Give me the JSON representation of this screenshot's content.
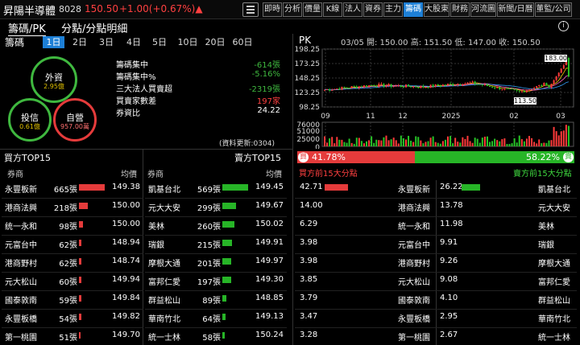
{
  "header": {
    "stock_name": "昇陽半導體",
    "stock_code": "8028",
    "price": "150.50",
    "change": "+1.00(+0.67%)▲",
    "tabs": [
      "即時",
      "分析",
      "價量",
      "K線",
      "法人",
      "資券",
      "主力",
      "籌碼",
      "大股東",
      "財務",
      "河流圖",
      "新聞/日曆",
      "董監/公司"
    ],
    "active_tab": "籌碼"
  },
  "subnav": {
    "tab1": "籌碼/PK",
    "tab2": "分點/分點明細",
    "info": "i"
  },
  "left": {
    "title": "籌碼",
    "periods": [
      "1日",
      "2日",
      "3日",
      "4日",
      "5日",
      "10日",
      "20日",
      "60日"
    ],
    "active_period": "1日",
    "rings": [
      {
        "label": "外資",
        "value": "2.95億",
        "color": "#3fb83f"
      },
      {
        "label": "投信",
        "value": "0.61億",
        "color": "#3fb83f"
      },
      {
        "label": "自營",
        "value": "957.00萬",
        "color": "#e53b3b"
      }
    ],
    "stats": [
      {
        "label": "籌碼集中",
        "value": "-614張",
        "color": "#3fb83f"
      },
      {
        "label": "籌碼集中%",
        "value": "-5.16%",
        "color": "#3fb83f"
      },
      {
        "label": "三大法人買賣超",
        "value": "-2319張",
        "color": "#3fb83f"
      },
      {
        "label": "買賣家數差",
        "value": "197家",
        "color": "#ff4040"
      },
      {
        "label": "券資比",
        "value": "24.22",
        "color": "#ffffff"
      }
    ],
    "update_note": "(資料更新:0304)"
  },
  "chart": {
    "pk_label": "PK",
    "ohlc_text": "03/05 開: 150.00  高: 151.50  低: 147.00  收: 150.50",
    "y_ticks": [
      "198.25",
      "173.25",
      "148.25",
      "123.25",
      "98.25"
    ],
    "vol_ticks": [
      "76000",
      "51000",
      "25000",
      "0"
    ],
    "x_ticks": [
      "09",
      "11",
      "12",
      "2025",
      "02",
      "03"
    ],
    "max_label": "183.00",
    "min_label": "113.50",
    "colors": {
      "up": "#ff3a3a",
      "down": "#27c427",
      "ma1": "#f0c800",
      "ma2": "#ff66cc",
      "ma3": "#33a0ff"
    }
  },
  "chart_data": {
    "type": "line",
    "title": "PK",
    "x": [
      "09",
      "11",
      "12",
      "2025",
      "02",
      "03"
    ],
    "series": [
      {
        "name": "收",
        "values": [
          128,
          136,
          133,
          140,
          124,
          150.5
        ]
      }
    ],
    "ylim": [
      98.25,
      198.25
    ]
  },
  "ratio": {
    "left": "41.78%",
    "right": "58.22%",
    "left_badge": "買",
    "right_badge": "賣"
  },
  "buy_table": {
    "title": "買方TOP15",
    "col_broker": "券商",
    "col_avg": "均價",
    "rows": [
      {
        "broker": "永豐板新",
        "qty": "665張",
        "avg": "149.38",
        "bar": 0.95
      },
      {
        "broker": "港商法興",
        "qty": "218張",
        "avg": "150.00",
        "bar": 0.31
      },
      {
        "broker": "统一永和",
        "qty": "98張",
        "avg": "150.00",
        "bar": 0.14
      },
      {
        "broker": "元富台中",
        "qty": "62張",
        "avg": "148.94",
        "bar": 0.09
      },
      {
        "broker": "港商野村",
        "qty": "62張",
        "avg": "148.74",
        "bar": 0.09
      },
      {
        "broker": "元大松山",
        "qty": "60張",
        "avg": "149.94",
        "bar": 0.09
      },
      {
        "broker": "國泰敦南",
        "qty": "59張",
        "avg": "149.84",
        "bar": 0.08
      },
      {
        "broker": "永豐板橋",
        "qty": "54張",
        "avg": "149.82",
        "bar": 0.08
      },
      {
        "broker": "第一桃園",
        "qty": "51張",
        "avg": "149.70",
        "bar": 0.07
      }
    ]
  },
  "sell_table": {
    "title": "賣方TOP15",
    "col_broker": "券商",
    "col_avg": "均價",
    "rows": [
      {
        "broker": "凱基台北",
        "qty": "569張",
        "avg": "149.45",
        "bar": 0.95
      },
      {
        "broker": "元大大安",
        "qty": "299張",
        "avg": "149.67",
        "bar": 0.5
      },
      {
        "broker": "美林",
        "qty": "260張",
        "avg": "150.02",
        "bar": 0.43
      },
      {
        "broker": "瑞銀",
        "qty": "215張",
        "avg": "149.91",
        "bar": 0.36
      },
      {
        "broker": "摩根大通",
        "qty": "201張",
        "avg": "149.97",
        "bar": 0.33
      },
      {
        "broker": "富邦仁愛",
        "qty": "197張",
        "avg": "149.30",
        "bar": 0.33
      },
      {
        "broker": "群益松山",
        "qty": "89張",
        "avg": "148.85",
        "bar": 0.15
      },
      {
        "broker": "華南竹北",
        "qty": "64張",
        "avg": "149.13",
        "bar": 0.11
      },
      {
        "broker": "統一士林",
        "qty": "58張",
        "avg": "150.24",
        "bar": 0.1
      }
    ]
  },
  "pk_table": {
    "buy_title": "買方前15大分點",
    "sell_title": "賣方前15大分點",
    "rows": [
      {
        "bval": "42.71",
        "bname": "永豐板新",
        "sval": "26.22",
        "sname": "凱基台北",
        "bbar": 0.95,
        "sbar": 0.6
      },
      {
        "bval": "14.00",
        "bname": "港商法興",
        "sval": "13.78",
        "sname": "元大大安",
        "bbar": 0.0,
        "sbar": 0.0
      },
      {
        "bval": "6.29",
        "bname": "統一永和",
        "sval": "11.98",
        "sname": "美林",
        "bbar": 0.0,
        "sbar": 0.0
      },
      {
        "bval": "3.98",
        "bname": "元富台中",
        "sval": "9.91",
        "sname": "瑞銀",
        "bbar": 0.0,
        "sbar": 0.0
      },
      {
        "bval": "3.98",
        "bname": "港商野村",
        "sval": "9.26",
        "sname": "摩根大通",
        "bbar": 0.0,
        "sbar": 0.0
      },
      {
        "bval": "3.85",
        "bname": "元大松山",
        "sval": "9.08",
        "sname": "富邦仁愛",
        "bbar": 0.0,
        "sbar": 0.0
      },
      {
        "bval": "3.79",
        "bname": "國泰敦南",
        "sval": "4.10",
        "sname": "群益松山",
        "bbar": 0.0,
        "sbar": 0.0
      },
      {
        "bval": "3.47",
        "bname": "永豐板橋",
        "sval": "2.95",
        "sname": "華南竹北",
        "bbar": 0.0,
        "sbar": 0.0
      },
      {
        "bval": "3.28",
        "bname": "第一桃園",
        "sval": "2.67",
        "sname": "統一士林",
        "bbar": 0.0,
        "sbar": 0.0
      }
    ]
  }
}
